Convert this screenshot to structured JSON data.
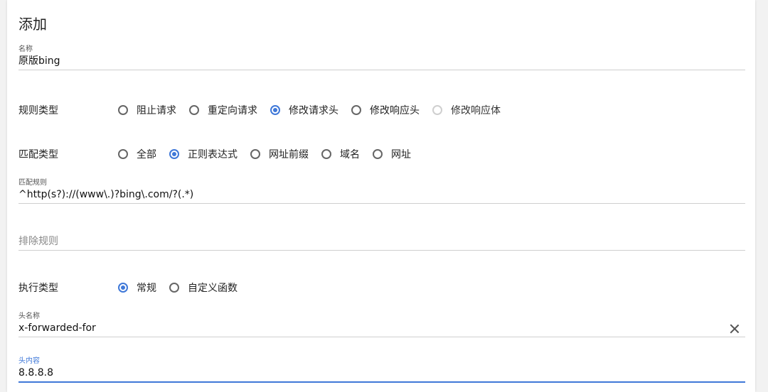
{
  "header": {
    "title": "添加"
  },
  "name_field": {
    "label": "名称",
    "value": "原版bing"
  },
  "rule_type": {
    "label": "规则类型",
    "options": [
      {
        "label": "阻止请求",
        "checked": false,
        "disabled": false
      },
      {
        "label": "重定向请求",
        "checked": false,
        "disabled": false
      },
      {
        "label": "修改请求头",
        "checked": true,
        "disabled": false
      },
      {
        "label": "修改响应头",
        "checked": false,
        "disabled": false
      },
      {
        "label": "修改响应体",
        "checked": false,
        "disabled": true
      }
    ]
  },
  "match_type": {
    "label": "匹配类型",
    "options": [
      {
        "label": "全部",
        "checked": false
      },
      {
        "label": "正则表达式",
        "checked": true
      },
      {
        "label": "网址前缀",
        "checked": false
      },
      {
        "label": "域名",
        "checked": false
      },
      {
        "label": "网址",
        "checked": false
      }
    ]
  },
  "match_rule": {
    "label": "匹配规则",
    "value": "^http(s?)://(www\\.)?bing\\.com/?(.*)"
  },
  "exclude_rule": {
    "placeholder": "排除规则"
  },
  "exec_type": {
    "label": "执行类型",
    "options": [
      {
        "label": "常规",
        "checked": true
      },
      {
        "label": "自定义函数",
        "checked": false
      }
    ]
  },
  "header_name": {
    "label": "头名称",
    "value": "x-forwarded-for",
    "clear_icon": "close-icon"
  },
  "header_value": {
    "label": "头内容",
    "value": "8.8.8.8"
  },
  "colors": {
    "accent": "#3f78d8",
    "border": "#cfcfcf"
  }
}
